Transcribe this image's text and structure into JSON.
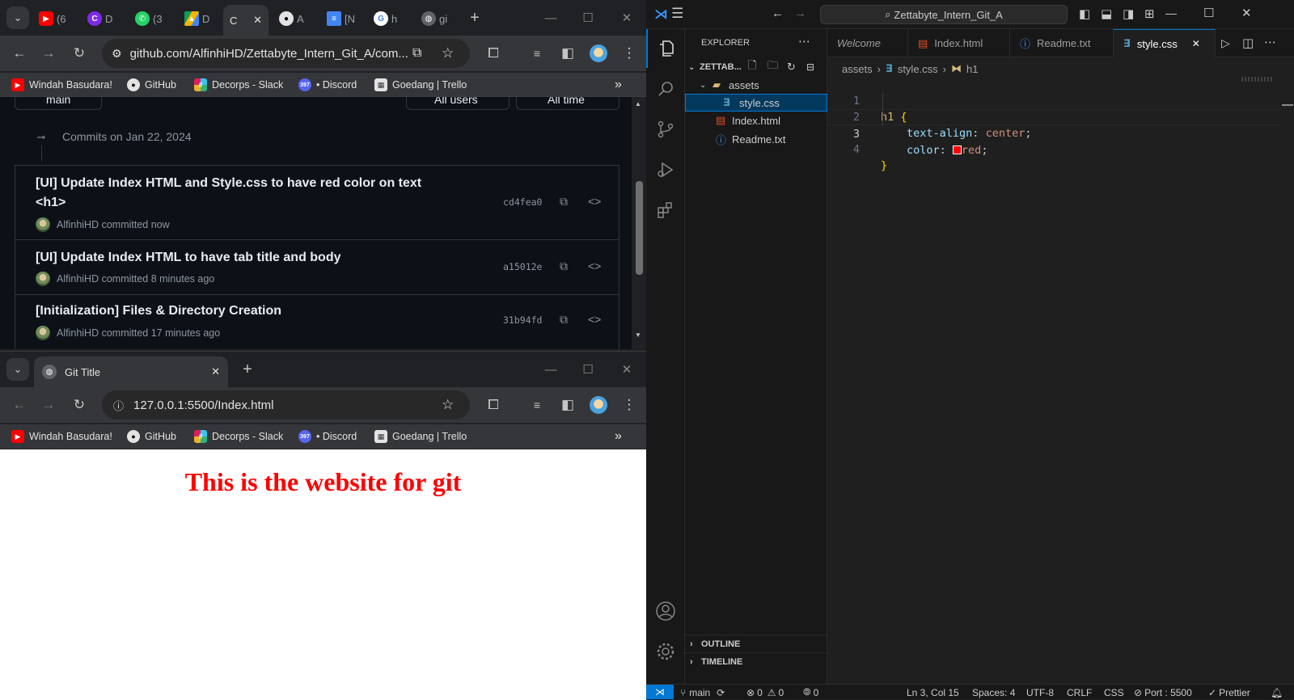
{
  "browser_top": {
    "tabs": [
      {
        "icon": "youtube-icon",
        "label": "(6"
      },
      {
        "icon": "canva-icon",
        "label": "D"
      },
      {
        "icon": "whatsapp-icon",
        "label": "(3"
      },
      {
        "icon": "drive-icon",
        "label": "D"
      },
      {
        "icon": "github-icon",
        "label": "A"
      },
      {
        "icon": "docs-icon",
        "label": "[N"
      },
      {
        "icon": "google-icon",
        "label": "h"
      },
      {
        "icon": "globe-icon",
        "label": "gi"
      }
    ],
    "active_tab_label": "C",
    "url": "github.com/AlfinhiHD/Zettabyte_Intern_Git_A/com...",
    "bookmarks": [
      "Windah Basudara!",
      "GitHub",
      "Decorps - Slack",
      "• Discord",
      "Goedang | Trello"
    ],
    "discord_badge": "397",
    "github": {
      "branch_label": "main",
      "users_filter": "All users",
      "time_filter": "All time",
      "commits_date": "Commits on Jan 22, 2024",
      "commits": [
        {
          "title": "[UI] Update Index HTML and Style.css to have red color on text",
          "title2": "<h1>",
          "author": "AlfinhiHD",
          "meta": "committed now",
          "sha": "cd4fea0"
        },
        {
          "title": "[UI] Update Index HTML to have tab title and body",
          "title2": "",
          "author": "AlfinhiHD",
          "meta": "committed 8 minutes ago",
          "sha": "a15012e"
        },
        {
          "title": "[Initialization] Files & Directory Creation",
          "title2": "",
          "author": "AlfinhiHD",
          "meta": "committed 17 minutes ago",
          "sha": "31b94fd"
        }
      ]
    }
  },
  "browser_bottom": {
    "tab_title": "Git Title",
    "url": "127.0.0.1:5500/Index.html",
    "bookmarks": [
      "Windah Basudara!",
      "GitHub",
      "Decorps - Slack",
      "• Discord",
      "Goedang | Trello"
    ],
    "discord_badge": "397",
    "page_heading": "This is the website for git"
  },
  "vscode": {
    "search_text": "Zettabyte_Intern_Git_A",
    "explorer_title": "EXPLORER",
    "root_folder": "ZETTAB...",
    "tree": {
      "folder": "assets",
      "file_css": "style.css",
      "file_html": "Index.html",
      "file_txt": "Readme.txt"
    },
    "tabs": [
      "Welcome",
      "Index.html",
      "Readme.txt",
      "style.css"
    ],
    "breadcrumb": {
      "folder": "assets",
      "file": "style.css",
      "symbol": "h1"
    },
    "code": {
      "line_numbers": [
        "1",
        "2",
        "3",
        "4"
      ],
      "selector": "h1",
      "open_brace": "{",
      "prop1": "text-align",
      "val1": "center",
      "prop2": "color",
      "val2": "red",
      "colon": ":",
      "semicolon": ";",
      "close_brace": "}",
      "swatch_color": "#ff0000"
    },
    "outline_label": "OUTLINE",
    "timeline_label": "TIMELINE",
    "status": {
      "branch": "main",
      "errors": "0",
      "warnings": "0",
      "ports": "0",
      "position": "Ln 3, Col 15",
      "spaces": "Spaces: 4",
      "encoding": "UTF-8",
      "eol": "CRLF",
      "language": "CSS",
      "port": "Port : 5500",
      "prettier": "Prettier"
    }
  }
}
